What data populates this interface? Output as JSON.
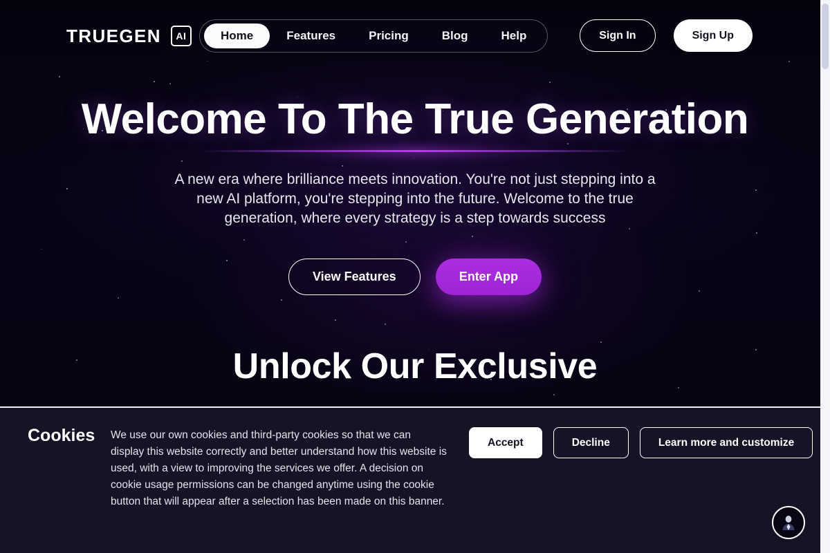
{
  "brand": {
    "name": "TRUEGEN",
    "badge": "AI"
  },
  "nav": {
    "items": [
      {
        "label": "Home",
        "active": true
      },
      {
        "label": "Features",
        "active": false
      },
      {
        "label": "Pricing",
        "active": false
      },
      {
        "label": "Blog",
        "active": false
      },
      {
        "label": "Help",
        "active": false
      }
    ]
  },
  "auth": {
    "sign_in": "Sign In",
    "sign_up": "Sign Up"
  },
  "hero": {
    "title": "Welcome To The True Generation",
    "subtitle": "A new era where brilliance meets innovation. You're not just stepping into a new AI platform, you're stepping into the future. Welcome to the true generation, where every strategy is a step towards success",
    "cta_secondary": "View Features",
    "cta_primary": "Enter App"
  },
  "section2": {
    "title": "Unlock Our Exclusive"
  },
  "cookies": {
    "title": "Cookies",
    "body": "We use our own cookies and third-party cookies so that we can display this website correctly and better understand how this website is used, with a view to improving the services we offer. A decision on cookie usage permissions can be changed anytime using the cookie button that will appear after a selection has been made on this banner.",
    "accept": "Accept",
    "decline": "Decline",
    "learn_more": "Learn more and customize"
  },
  "assistant": {
    "icon": "avatar-icon"
  },
  "colors": {
    "page_background": "#05040f",
    "accent_purple": "#a32ad4",
    "beam_purple": "#c23cf0",
    "cookie_background": "#151326",
    "text_primary": "#ffffff",
    "scrollbar_track": "#f4f5fa",
    "scrollbar_thumb": "#ccd0e0"
  }
}
